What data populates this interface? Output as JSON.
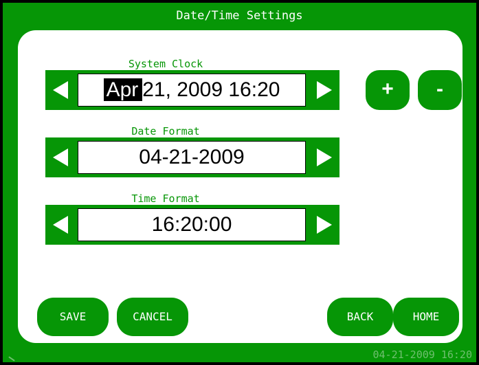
{
  "window": {
    "title": "Date/Time Settings"
  },
  "system_clock": {
    "label": "System Clock",
    "selected_segment": "Apr",
    "rest": "21, 2009 16:20"
  },
  "date_format": {
    "label": "Date Format",
    "value": "04-21-2009"
  },
  "time_format": {
    "label": "Time Format",
    "value": "16:20:00"
  },
  "buttons": {
    "plus": "+",
    "minus": "-",
    "save": "SAVE",
    "cancel": "CANCEL",
    "back": "BACK",
    "home": "HOME"
  },
  "footer": {
    "datetime": "04-21-2009 16:20"
  },
  "colors": {
    "accent": "#069606",
    "panel": "#ffffff",
    "border": "#000000"
  }
}
